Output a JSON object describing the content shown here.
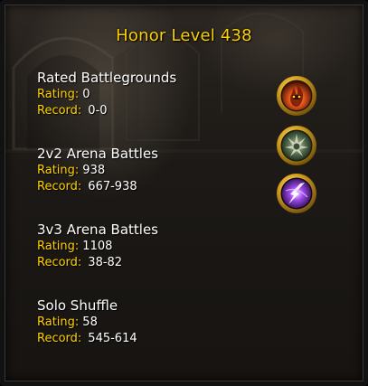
{
  "title": "Honor Level 438",
  "sections": [
    {
      "name": "Rated Battlegrounds",
      "rating_label": "Rating:",
      "rating": "0",
      "record_label": "Record:",
      "record": "0-0"
    },
    {
      "name": "2v2 Arena Battles",
      "rating_label": "Rating:",
      "rating": "938",
      "record_label": "Record:",
      "record": "667-938"
    },
    {
      "name": "3v3 Arena Battles",
      "rating_label": "Rating:",
      "rating": "1108",
      "record_label": "Record:",
      "record": "38-82"
    },
    {
      "name": "Solo Shuffle",
      "rating_label": "Rating:",
      "rating": "58",
      "record_label": "Record:",
      "record": "545-614"
    }
  ],
  "talents": [
    {
      "icon": "fire-talent-icon"
    },
    {
      "icon": "thorn-talent-icon"
    },
    {
      "icon": "arcane-talent-icon"
    }
  ],
  "colors": {
    "accent": "#ffd100",
    "text": "#ffffff",
    "background": "#1c1916"
  }
}
